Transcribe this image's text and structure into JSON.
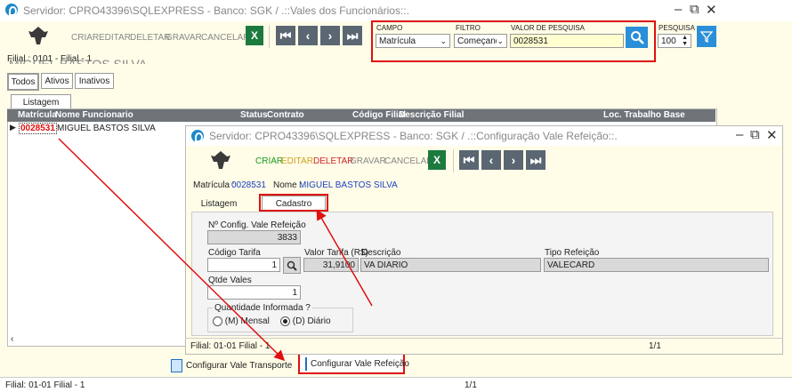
{
  "main": {
    "title": "Servidor: CPRO43396\\SQLEXPRESS - Banco: SGK / .::Vales dos Funcionários::.",
    "toolbar": {
      "criar": "CRIAR",
      "editar": "EDITAR",
      "deletar": "DELETAR",
      "gravar": "GRAVAR",
      "cancelar": "CANCELAR"
    },
    "search": {
      "campo_label": "CAMPO",
      "campo_value": "Matrícula",
      "filtro_label": "FILTRO",
      "filtro_value": "Começando",
      "valor_label": "VALOR DE PESQUISA",
      "valor_value": "0028531",
      "pesquisa_label": "PESQUISA",
      "pesquisa_value": "100"
    },
    "filial": "Filial : 0101 - Filial - 1",
    "ghost_name": "MIGUEL BASTOS SILVA",
    "status_tabs": [
      "Todos",
      "Ativos",
      "Inativos"
    ],
    "listagem_tab": "Listagem",
    "grid": {
      "headers": [
        "Matrícula",
        "Nome Funcionario",
        "Status",
        "Contrato",
        "Código Filial",
        "Descrição Filial",
        "Loc. Trabalho Base"
      ],
      "row": {
        "matricula": "0028531",
        "nome": "MIGUEL BASTOS SILVA"
      }
    },
    "bottom_buttons": {
      "transporte": "Configurar Vale Transporte",
      "refeicao": "Configurar Vale Refeição"
    },
    "status_bar": {
      "filial": "Filial: 01-01 Filial - 1",
      "page": "1/1"
    }
  },
  "modal": {
    "title": "Servidor: CPRO43396\\SQLEXPRESS - Banco: SGK / .::Configuração Vale Refeição::.",
    "toolbar": {
      "criar": "CRIAR",
      "editar": "EDITAR",
      "deletar": "DELETAR",
      "gravar": "GRAVAR",
      "cancelar": "CANCELAR"
    },
    "matricula_label": "Matrícula :",
    "matricula_value": "0028531",
    "nome_label": "Nome :",
    "nome_value": "MIGUEL BASTOS SILVA",
    "tabs": [
      "Listagem",
      "Cadastro"
    ],
    "form": {
      "nconfig_label": "Nº Config. Vale Refeição",
      "nconfig_value": "3833",
      "codigo_label": "Código Tarifa",
      "codigo_value": "1",
      "valor_label": "Valor Tarifa (R$)",
      "valor_value": "31,9100",
      "descricao_label": "Descrição",
      "descricao_value": "VA DIARIO",
      "tipo_label": "Tipo Refeição",
      "tipo_value": "VALECARD",
      "qtde_label": "Qtde Vales",
      "qtde_value": "1",
      "qtd_group_label": "Quantidade Informada ?",
      "radio_mensal": "(M) Mensal",
      "radio_diario": "(D) Diário"
    },
    "status_bar": {
      "filial": "Filial: 01-01 Filial - 1",
      "page": "1/1"
    }
  },
  "colors": {
    "accent_red": "#e01010",
    "toolbar_red": "#d42020",
    "toolbar_green": "#1a9a1a",
    "toolbar_yellow": "#d0a020",
    "link_blue": "#1a3fbf"
  }
}
